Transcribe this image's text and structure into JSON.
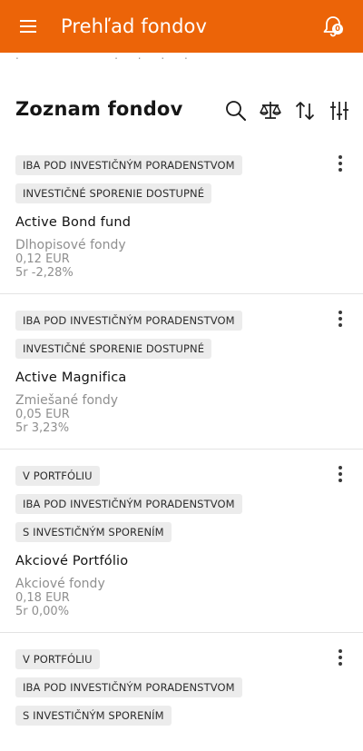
{
  "app_bar": {
    "title": "Prehľad fondov",
    "notification_count": "0",
    "accent": "#ec6408"
  },
  "clipped_text": ". ˇ ˇ ˇ . . . .",
  "section": {
    "title": "Zoznam fondov",
    "tools": [
      "search-icon",
      "scales-icon",
      "sort-icon",
      "filter-sliders-icon"
    ]
  },
  "funds": [
    {
      "tags": [
        "IBA POD INVESTIČNÝM PORADENSTVOM",
        "INVESTIČNÉ SPORENIE DOSTUPNÉ"
      ],
      "name": "Active Bond fund",
      "category": "Dlhopisové fondy",
      "price": "0,12 EUR",
      "performance": "5r -2,28%"
    },
    {
      "tags": [
        "IBA POD INVESTIČNÝM PORADENSTVOM",
        "INVESTIČNÉ SPORENIE DOSTUPNÉ"
      ],
      "name": "Active Magnifica",
      "category": "Zmiešané fondy",
      "price": "0,05 EUR",
      "performance": "5r 3,23%"
    },
    {
      "tags": [
        "V PORTFÓLIU",
        "IBA POD INVESTIČNÝM PORADENSTVOM",
        "S INVESTIČNÝM SPORENÍM"
      ],
      "name": "Akciové Portfólio",
      "category": "Akciové fondy",
      "price": "0,18 EUR",
      "performance": "5r 0,00%"
    },
    {
      "tags": [
        "V PORTFÓLIU",
        "IBA POD INVESTIČNÝM PORADENSTVOM",
        "S INVESTIČNÝM SPORENÍM"
      ]
    }
  ]
}
